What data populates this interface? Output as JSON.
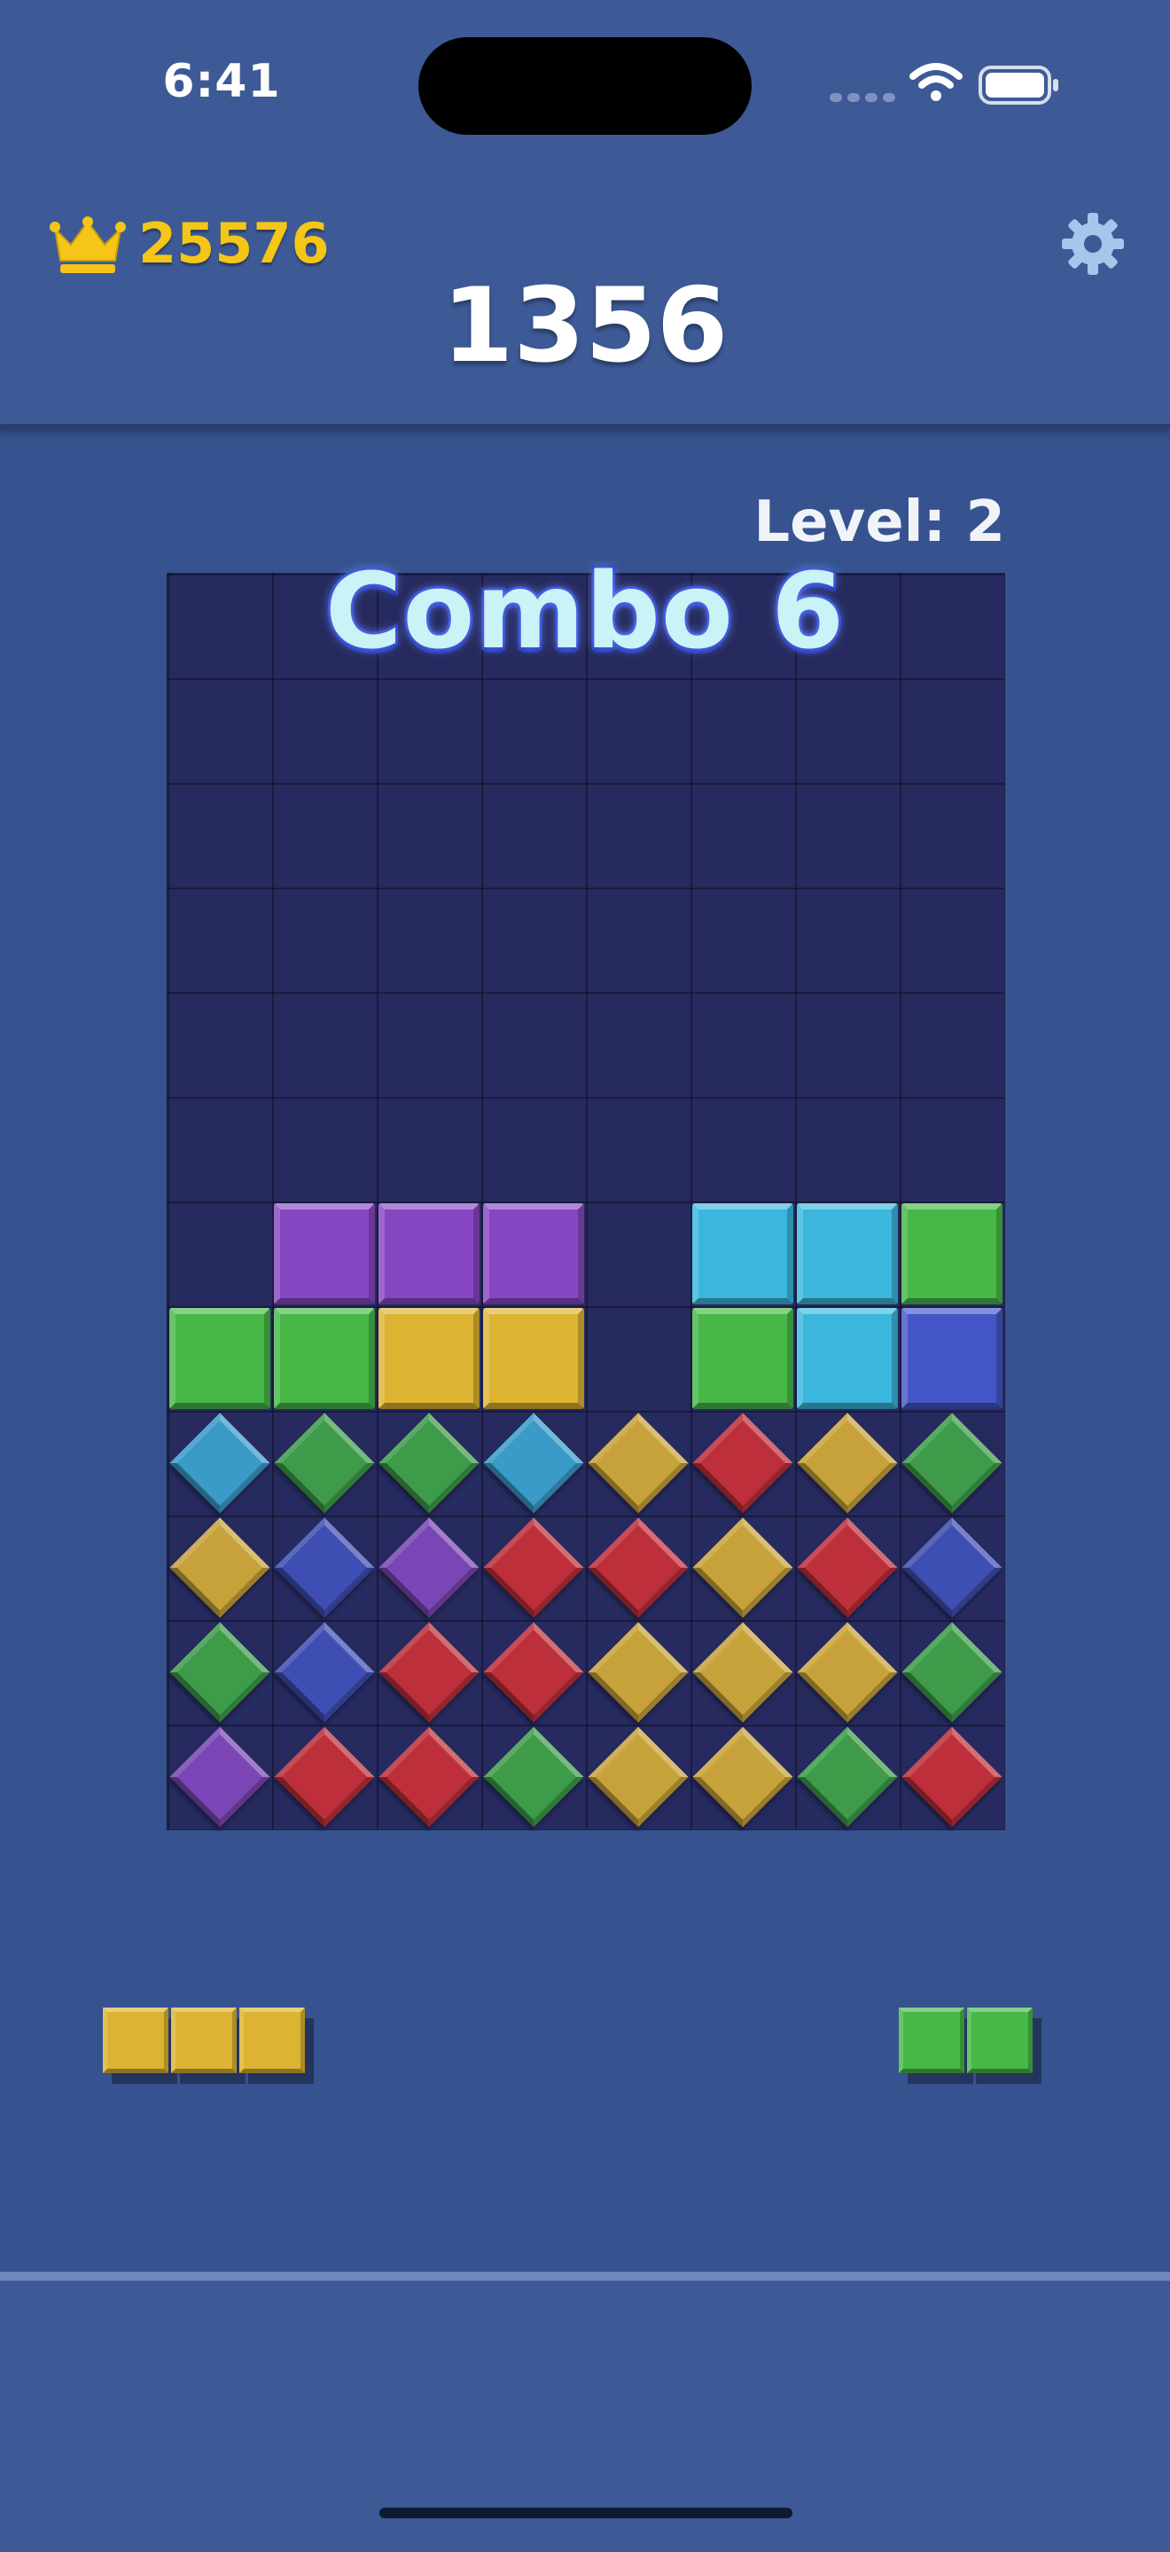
{
  "status_bar": {
    "time": "6:41"
  },
  "header": {
    "best_score": "25576",
    "score": "1356"
  },
  "level_label": "Level: 2",
  "combo_text": "Combo 6",
  "colors": {
    "P": "#8847c2",
    "C": "#3bb7dd",
    "G": "#47b847",
    "Y": "#ddb432",
    "B": "#4556c8",
    "c": "#3a9ac8",
    "g": "#3d9b4a",
    "y": "#c7a23a",
    "r": "#bd2f3a",
    "b": "#3e4eb2",
    "p": "#7a46b5"
  },
  "board": {
    "columns": 8,
    "rows": 12,
    "grid": [
      "........",
      "........",
      "........",
      "........",
      "........",
      "........",
      ".PPP.CCG",
      "GGYY.GCB",
      "cggcyryg",
      "ybprryrb",
      "gbrryyyg",
      "prrgyygr"
    ]
  },
  "tray": {
    "pieces": [
      {
        "name": "yellow-three-piece",
        "color": "Y",
        "length": 3
      },
      {
        "name": "green-two-piece",
        "color": "G",
        "length": 2
      }
    ]
  }
}
